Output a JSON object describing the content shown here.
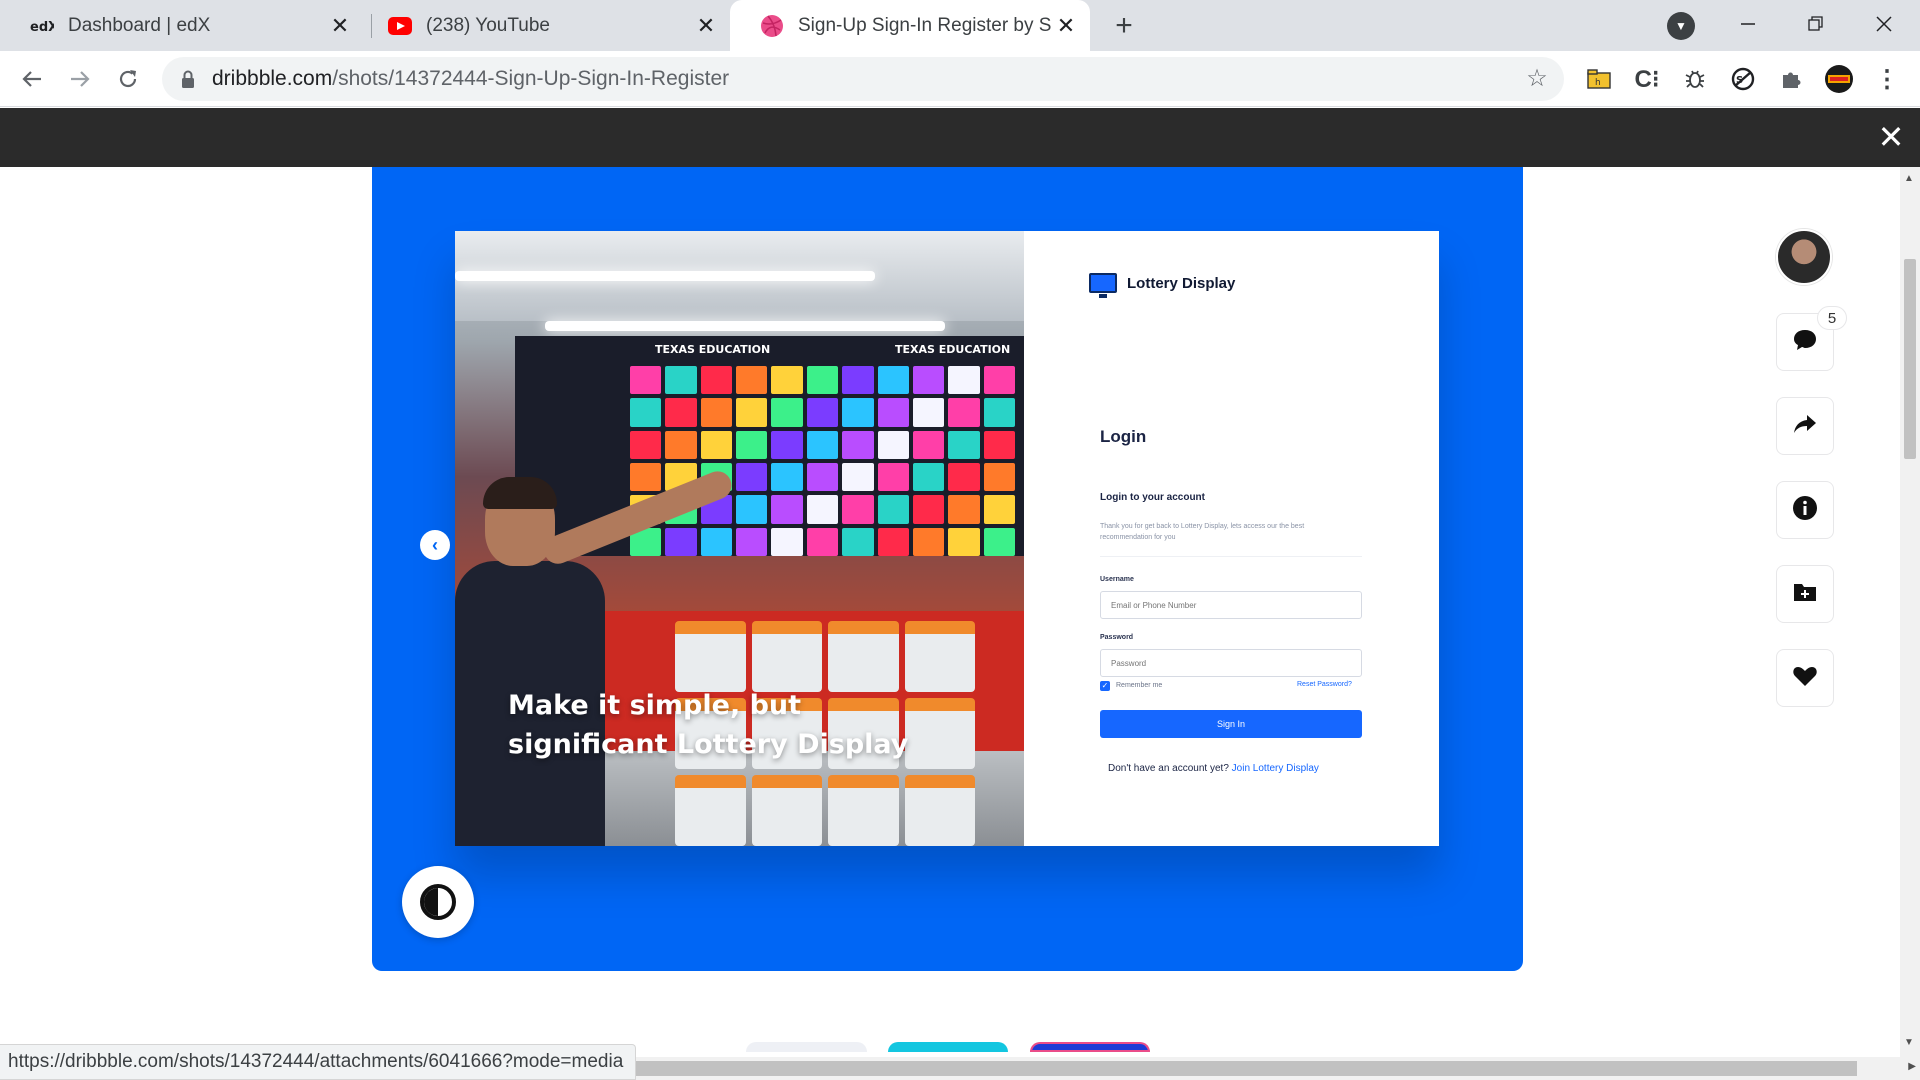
{
  "browser": {
    "tabs": [
      {
        "title": "Dashboard | edX",
        "favicon": "edx-logo-icon",
        "active": false
      },
      {
        "title": "(238) YouTube",
        "favicon": "youtube-icon",
        "active": false
      },
      {
        "title": "Sign-Up Sign-In Register by Shak",
        "favicon": "dribbble-icon",
        "active": true
      }
    ],
    "address": {
      "host": "dribbble.com",
      "path": "/shots/14372444-Sign-Up-Sign-In-Register"
    },
    "status_url": "https://dribbble.com/shots/14372444/attachments/6041666?mode=media"
  },
  "shot": {
    "headline": "Make it simple, but significant Lottery Display",
    "brand": "Lottery Display",
    "rack_banner": "TEXAS EDUCATION",
    "login_title": "Login",
    "login_subtitle": "Login to your account",
    "login_description": "Thank you for get back to Lottery Display, lets access our the best recommendation for you",
    "username_label": "Username",
    "username_placeholder": "Email or Phone Number",
    "password_label": "Password",
    "password_placeholder": "Password",
    "remember_label": "Remember me",
    "reset_link": "Reset Password?",
    "signin_button": "Sign In",
    "footer_text": "Don't have an account yet?",
    "footer_link": "Join Lottery Display"
  },
  "sidebar": {
    "comment_count": "5"
  },
  "colors": {
    "shot_background": "#0066f5",
    "brand_blue": "#1667ff",
    "overlay": "#2b2b2b"
  }
}
